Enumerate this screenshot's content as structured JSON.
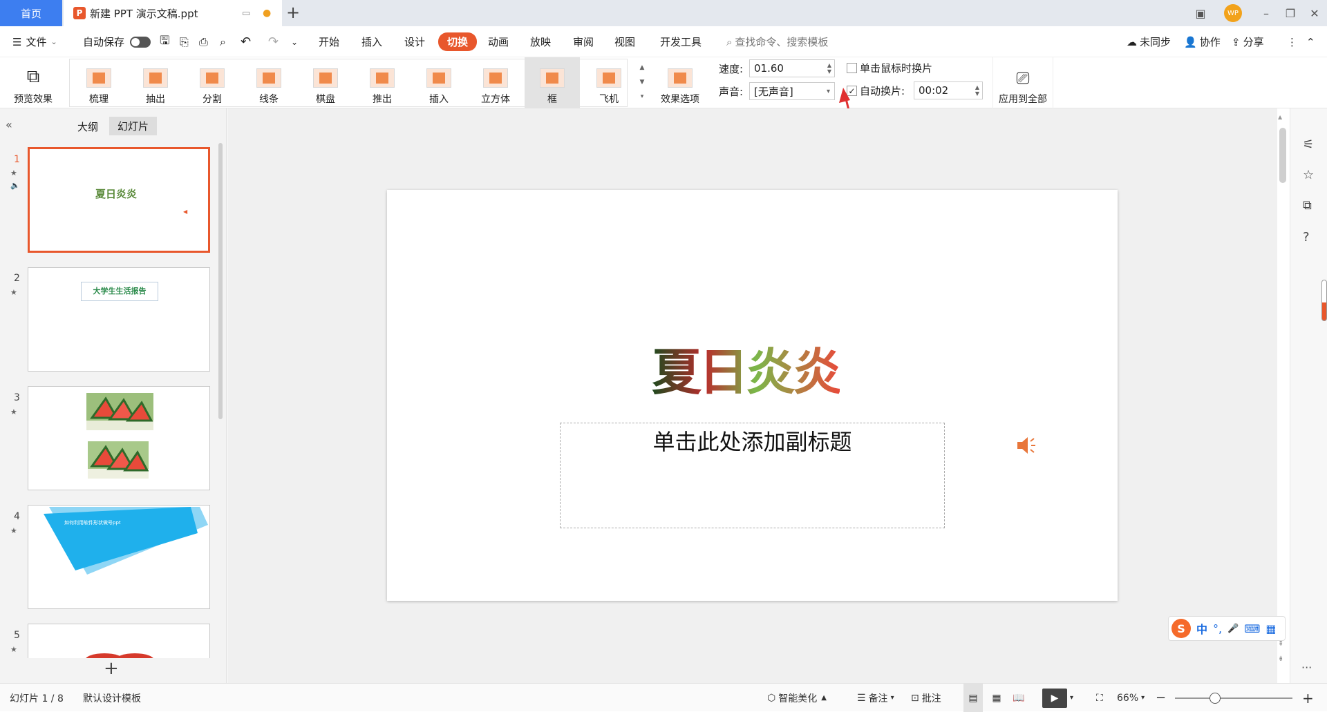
{
  "tabs": {
    "home": "首页",
    "doc": "新建 PPT 演示文稿.ppt",
    "add": "+"
  },
  "window": {
    "avatar": "WP",
    "minimize": "–",
    "restore": "❐",
    "close": "✕"
  },
  "menu": {
    "file": "文件",
    "autosave": "自动保存",
    "items": [
      "开始",
      "插入",
      "设计",
      "切换",
      "动画",
      "放映",
      "审阅",
      "视图",
      "开发工具"
    ],
    "active": "切换",
    "search": "查找命令、搜索模板",
    "sync": "未同步",
    "collab": "协作",
    "share": "分享"
  },
  "ribbon": {
    "preview": "预览效果",
    "transitions": [
      "梳理",
      "抽出",
      "分割",
      "线条",
      "棋盘",
      "推出",
      "插入",
      "立方体",
      "框",
      "飞机"
    ],
    "selected": "框",
    "effect_options": "效果选项",
    "speed_label": "速度:",
    "speed_value": "01.60",
    "sound_label": "声音:",
    "sound_value": "[无声音]",
    "on_click_label": "单击鼠标时换片",
    "on_click_checked": false,
    "auto_label": "自动换片:",
    "auto_checked": true,
    "auto_value": "00:02",
    "apply_all": "应用到全部"
  },
  "panel": {
    "tab_outline": "大纲",
    "tab_slides": "幻灯片",
    "slides": [
      {
        "num": "1",
        "text": "夏日炎炎"
      },
      {
        "num": "2",
        "text": "大学生生活报告"
      },
      {
        "num": "3",
        "text": ""
      },
      {
        "num": "4",
        "text": "如何利用软件形状做号ppt"
      },
      {
        "num": "5",
        "text": ""
      }
    ]
  },
  "slide": {
    "title": "夏日炎炎",
    "subtitle": "单击此处添加副标题"
  },
  "ime": {
    "label": "中",
    "items": [
      "°,",
      "🎤",
      "⌨",
      "▦"
    ]
  },
  "status": {
    "slide_info": "幻灯片 1 / 8",
    "template": "默认设计模板",
    "beautify": "智能美化",
    "notes": "备注",
    "comments": "批注",
    "zoom": "66%"
  },
  "colors": {
    "accent": "#e8572c",
    "home_tab": "#3d7ef0"
  }
}
